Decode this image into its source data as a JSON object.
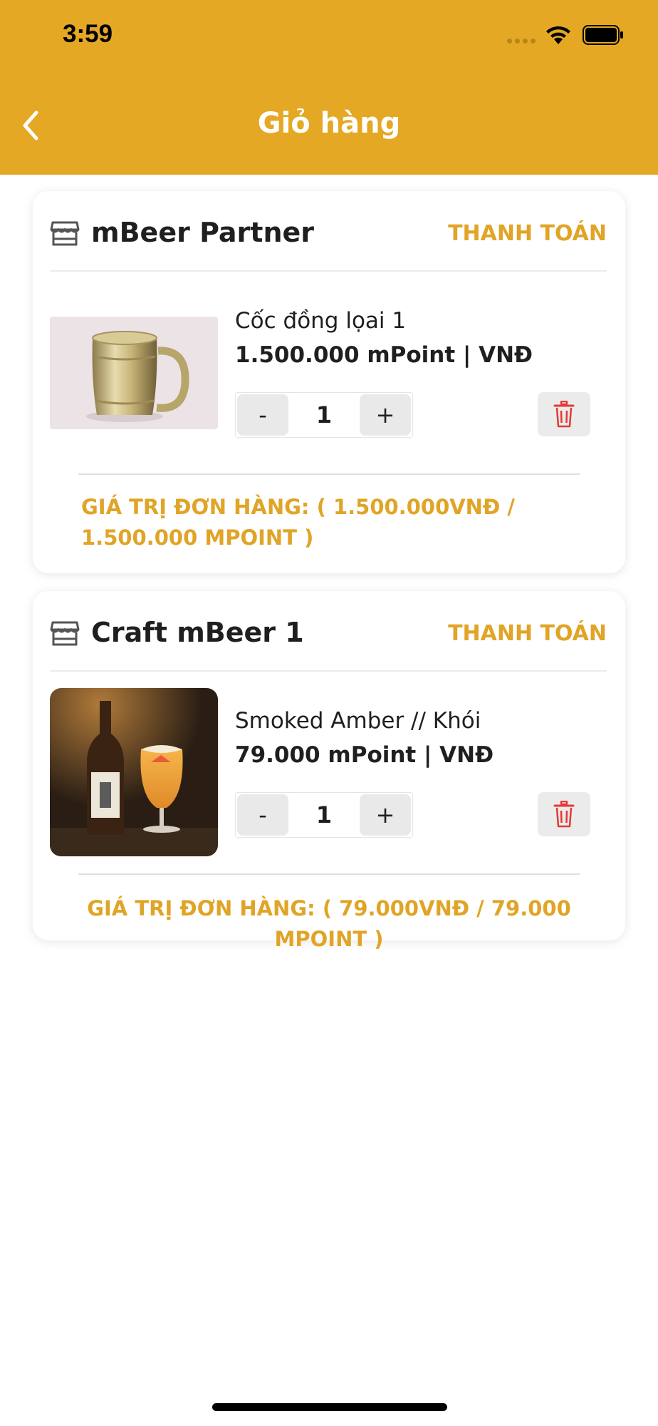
{
  "status_bar": {
    "time": "3:59"
  },
  "header": {
    "title": "Giỏ hàng"
  },
  "colors": {
    "brand": "#E5A824",
    "accent_text": "#E0A426",
    "delete_red": "#E53935"
  },
  "carts": [
    {
      "shop_name": "mBeer Partner",
      "checkout_label": "THANH TOÁN",
      "item": {
        "name": "Cốc đồng lọai 1",
        "price": "1.500.000 mPoint | VNĐ",
        "quantity": "1",
        "minus": "-",
        "plus": "+"
      },
      "order_total": "GIÁ TRỊ ĐƠN HÀNG: ( 1.500.000VNĐ / 1.500.000 MPOINT )"
    },
    {
      "shop_name": "Craft mBeer 1",
      "checkout_label": "THANH TOÁN",
      "item": {
        "name": " Smoked Amber // Khói",
        "price": "79.000 mPoint | VNĐ",
        "quantity": "1",
        "minus": "-",
        "plus": "+"
      },
      "order_total": "GIÁ TRỊ ĐƠN HÀNG: ( 79.000VNĐ / 79.000 MPOINT )"
    }
  ],
  "icons": {
    "back": "chevron-left-icon",
    "store": "store-icon",
    "delete": "trash-icon",
    "wifi": "wifi-icon",
    "battery": "battery-icon"
  }
}
